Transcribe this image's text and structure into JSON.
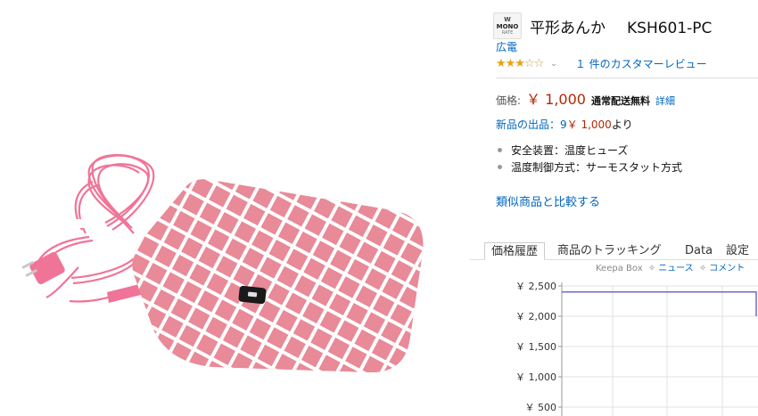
{
  "product": {
    "badge": {
      "top": "W",
      "word": "MONO",
      "rate": "RATE"
    },
    "title": "平形あんか",
    "model": "KSH601-PC",
    "brand": "広電",
    "stars": {
      "filled": 3,
      "total": 5
    },
    "review_link": "１ 件のカスタマーレビュー",
    "price_label": "価格:",
    "price": "￥ 1,000",
    "shipping": "通常配送無料",
    "detail_link": "詳細",
    "offers": {
      "link": "新品の出品：9",
      "price": "￥ 1,000",
      "suffix": "より"
    },
    "bullets": [
      "安全装置：温度ヒューズ",
      "温度制御方式：サーモスタット方式"
    ],
    "compare_link": "類似商品と比較する"
  },
  "keepa": {
    "tabs": [
      "価格履歴",
      "商品のトラッキング",
      "Data",
      "設定"
    ],
    "active_tab": 0,
    "box_label": "Keepa Box",
    "links": [
      "ニュース",
      "コメント"
    ]
  },
  "colors": {
    "link": "#0066c0",
    "price": "#b12704",
    "star": "#e8a317",
    "heater_pink": "#e88a98",
    "cord_pink": "#f07497",
    "chart_line": "#6b6bd6"
  },
  "chart_data": {
    "type": "line",
    "y_ticks": [
      "￥ 2,500",
      "￥ 2,000",
      "￥ 1,500",
      "￥ 1,000",
      "￥ 500"
    ],
    "ylim": [
      500,
      2500
    ],
    "series": [
      {
        "values": [
          2400,
          2400,
          2400,
          2400,
          2000
        ]
      }
    ],
    "grid": true
  }
}
